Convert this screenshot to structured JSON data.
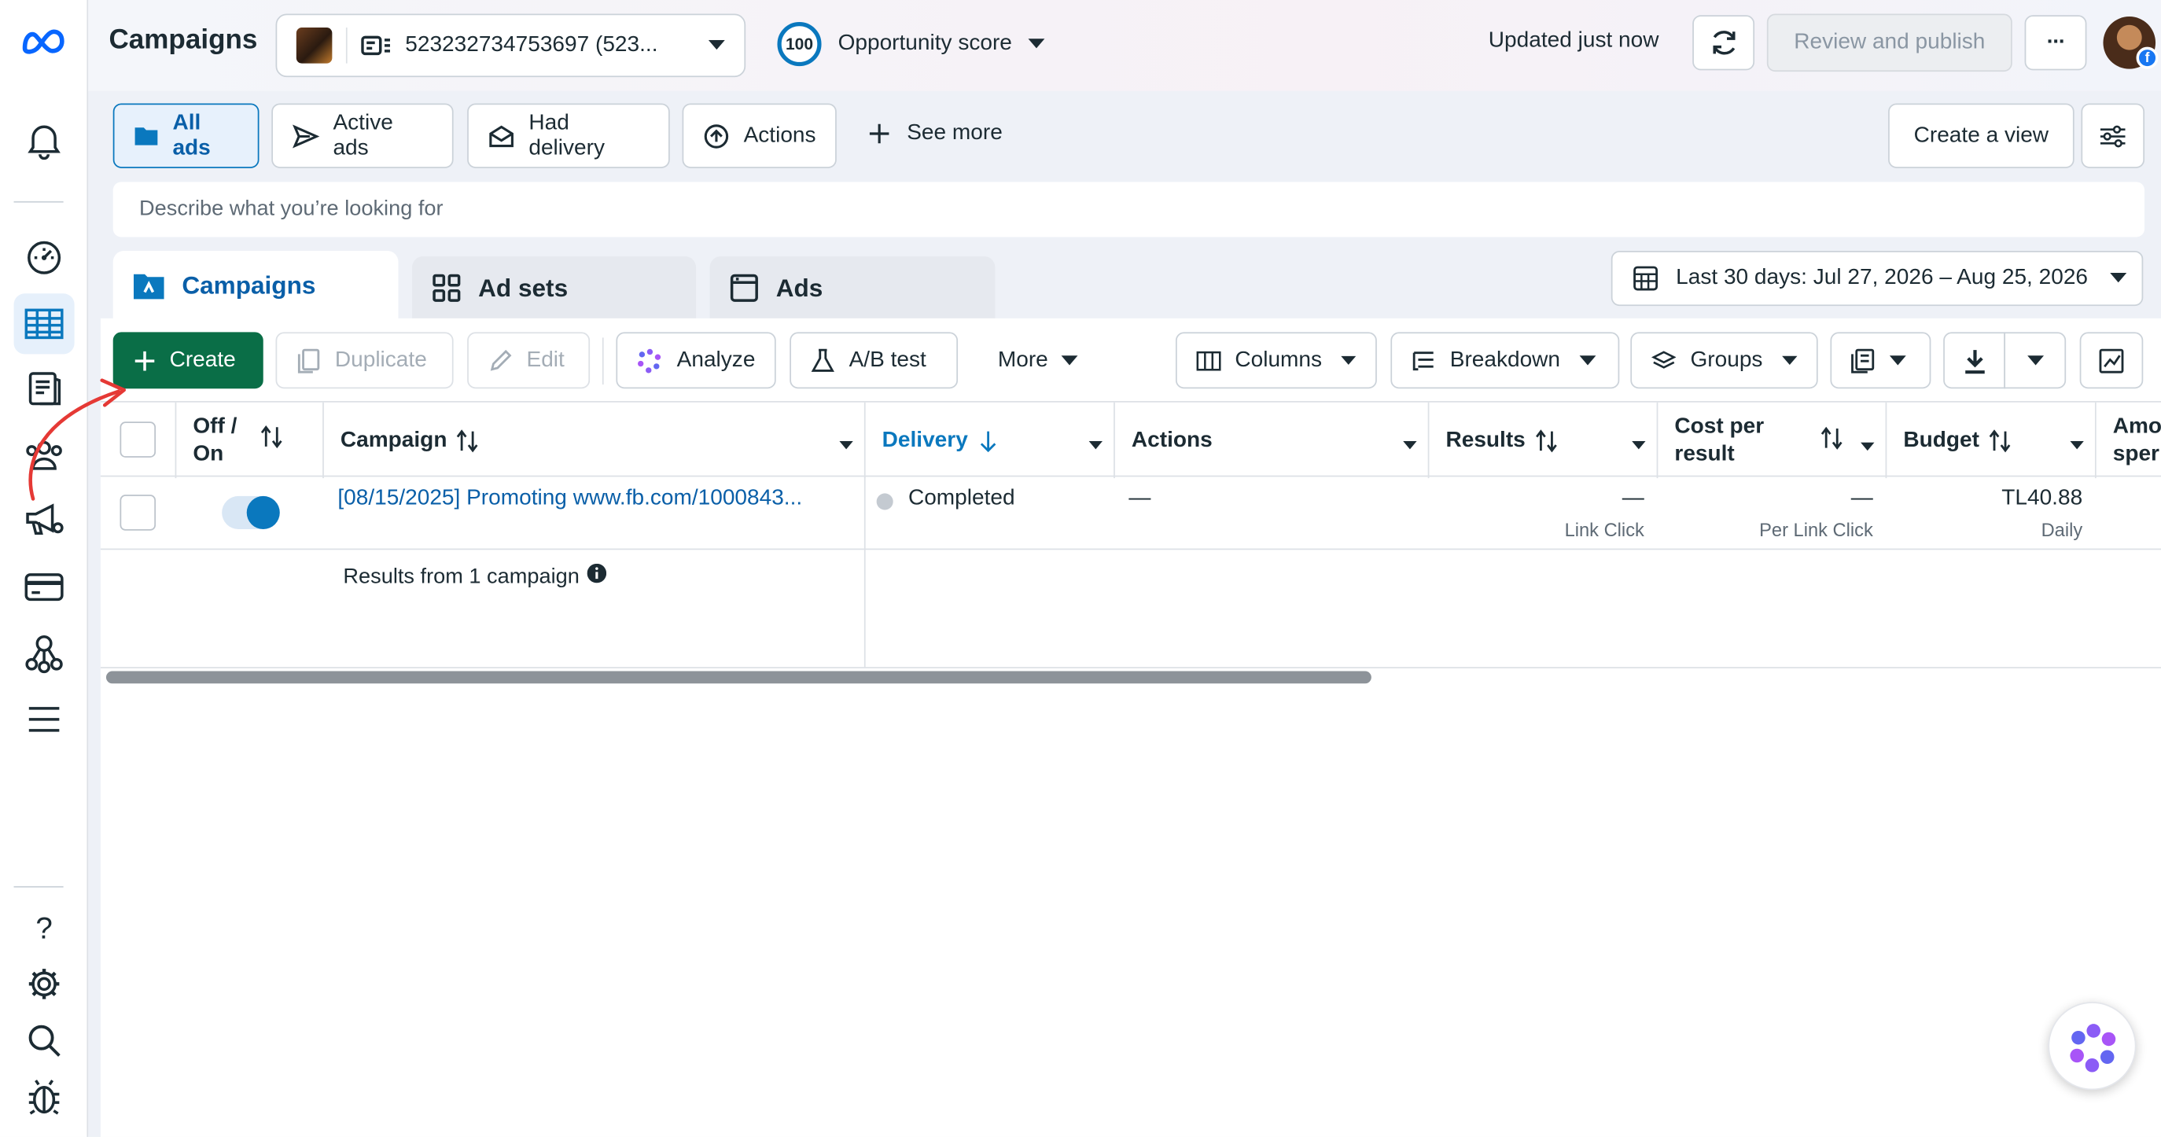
{
  "colors": {
    "accent": "#0a78be",
    "create_green": "#0a6e47",
    "annotation_arrow": "#e53935"
  },
  "header": {
    "title": "Campaigns",
    "account_label": "523232734753697 (523...",
    "opportunity_value": "100",
    "opportunity_label": "Opportunity score",
    "updated_text": "Updated just now",
    "review_publish_label": "Review and publish",
    "more_glyph": "···"
  },
  "filters": {
    "items": [
      {
        "label": "All ads",
        "icon": "folder-icon"
      },
      {
        "label": "Active ads",
        "icon": "send-icon"
      },
      {
        "label": "Had delivery",
        "icon": "envelope-icon"
      },
      {
        "label": "Actions",
        "icon": "upload-circle-icon"
      }
    ],
    "see_more": "See more",
    "create_view": "Create a view"
  },
  "search": {
    "placeholder": "Describe what you’re looking for"
  },
  "tabs": [
    {
      "label": "Campaigns",
      "icon": "campaign-folder-icon"
    },
    {
      "label": "Ad sets",
      "icon": "grid-icon"
    },
    {
      "label": "Ads",
      "icon": "ad-window-icon"
    }
  ],
  "date_range": "Last 30 days: Jul 27, 2026 – Aug 25, 2026",
  "toolbar": {
    "create": "Create",
    "duplicate": "Duplicate",
    "edit": "Edit",
    "analyze": "Analyze",
    "ab_test": "A/B test",
    "more": "More",
    "columns": "Columns",
    "breakdown": "Breakdown",
    "groups": "Groups"
  },
  "table": {
    "columns": {
      "off_on_line1": "Off /",
      "off_on_line2": "On",
      "campaign": "Campaign",
      "delivery": "Delivery",
      "actions": "Actions",
      "results": "Results",
      "cost_line1": "Cost per",
      "cost_line2": "result",
      "budget": "Budget",
      "amount_line1": "Amo",
      "amount_line2": "sper"
    },
    "row": {
      "campaign_name": "[08/15/2025] Promoting www.fb.com/1000843...",
      "delivery": "Completed",
      "actions": "—",
      "results": "—",
      "results_sub": "Link Click",
      "cost": "—",
      "cost_sub": "Per Link Click",
      "budget": "TL40.88",
      "budget_sub": "Daily",
      "toggle_on": true
    },
    "summary": "Results from 1 campaign"
  },
  "sidebar": {
    "icons": [
      "meta-logo-icon",
      "bell-icon",
      "gauge-icon",
      "table-icon",
      "catalog-icon",
      "audience-icon",
      "megaphone-icon",
      "billing-card-icon",
      "network-icon",
      "menu-icon",
      "help-icon",
      "settings-icon",
      "search-icon",
      "bug-icon"
    ],
    "help_glyph": "?"
  }
}
